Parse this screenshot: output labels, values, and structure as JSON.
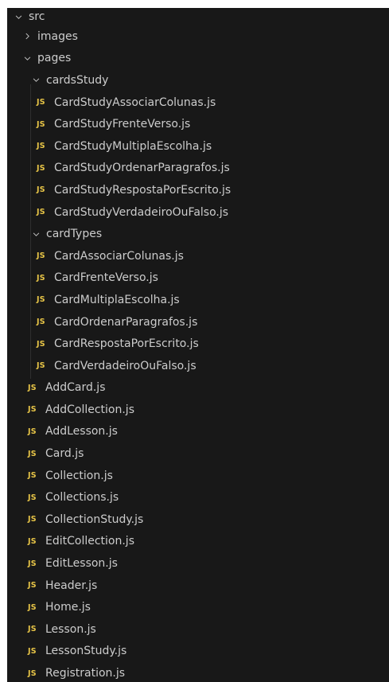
{
  "explorer": {
    "root": {
      "label": "src",
      "expanded": true
    },
    "folders": {
      "images": {
        "label": "images",
        "expanded": false
      },
      "pages": {
        "label": "pages",
        "expanded": true
      },
      "cardsStudy": {
        "label": "cardsStudy",
        "expanded": true
      },
      "cardTypes": {
        "label": "cardTypes",
        "expanded": true
      }
    },
    "file_badge": "JS",
    "cardsStudy_files": [
      "CardStudyAssociarColunas.js",
      "CardStudyFrenteVerso.js",
      "CardStudyMultiplaEscolha.js",
      "CardStudyOrdenarParagrafos.js",
      "CardStudyRespostaPorEscrito.js",
      "CardStudyVerdadeiroOuFalso.js"
    ],
    "cardTypes_files": [
      "CardAssociarColunas.js",
      "CardFrenteVerso.js",
      "CardMultiplaEscolha.js",
      "CardOrdenarParagrafos.js",
      "CardRespostaPorEscrito.js",
      "CardVerdadeiroOuFalso.js"
    ],
    "pages_files": [
      "AddCard.js",
      "AddCollection.js",
      "AddLesson.js",
      "Card.js",
      "Collection.js",
      "Collections.js",
      "CollectionStudy.js",
      "EditCollection.js",
      "EditLesson.js",
      "Header.js",
      "Home.js",
      "Lesson.js",
      "LessonStudy.js",
      "Registration.js"
    ]
  },
  "colors": {
    "background": "#181818",
    "text": "#cccccc",
    "js_badge": "#e8c547"
  },
  "icons": {
    "expanded": "chevron-down-icon",
    "collapsed": "chevron-right-icon",
    "file": "javascript-file-icon"
  }
}
